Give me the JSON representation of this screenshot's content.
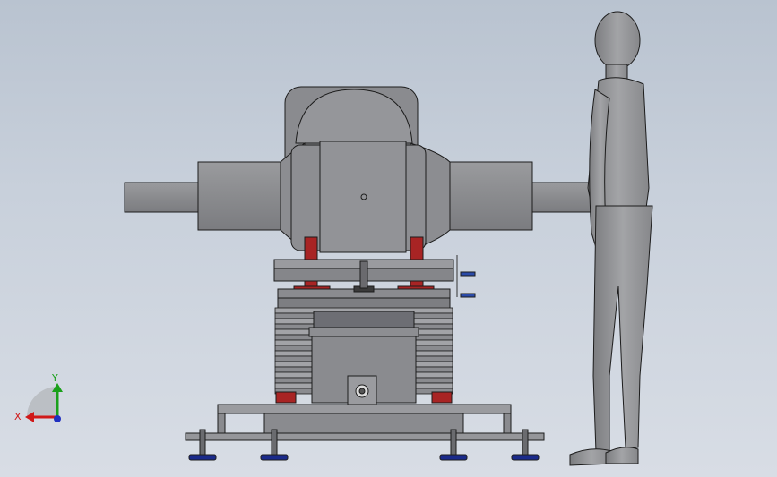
{
  "viewport": {
    "background_top": "#b9c3d0",
    "background_bottom": "#d8dde5"
  },
  "triad": {
    "x_label": "X",
    "y_label": "Y",
    "x_color": "#d01818",
    "y_color": "#1aa01a",
    "z_color": "#2030c0"
  },
  "model": {
    "body_color": "#8f9093",
    "edge_color": "#1c1c1c",
    "bracket_color": "#a82424",
    "foot_color": "#1a2a8a",
    "handle_color": "#2a4aa8"
  }
}
